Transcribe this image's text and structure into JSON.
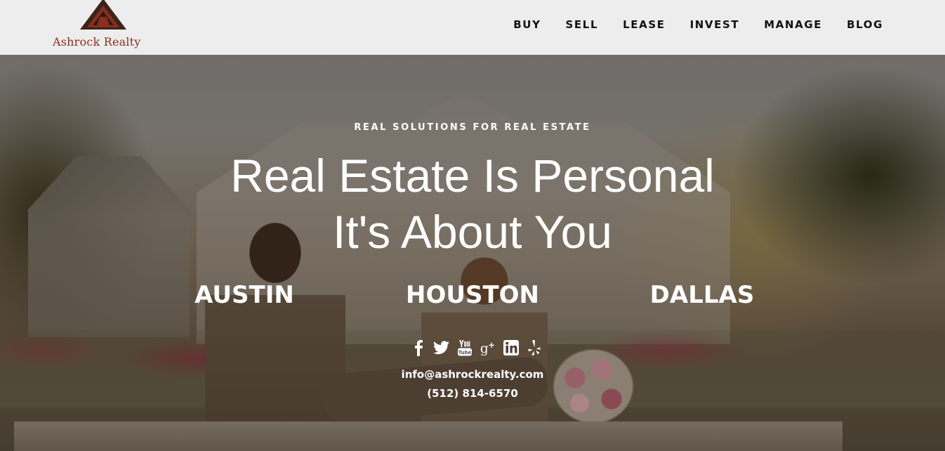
{
  "brand": {
    "name": "Ashrock Realty",
    "colors": {
      "logo_red": "#8a2d1f",
      "logo_dark": "#3a2418"
    }
  },
  "nav": {
    "items": [
      {
        "label": "BUY"
      },
      {
        "label": "SELL"
      },
      {
        "label": "LEASE"
      },
      {
        "label": "INVEST"
      },
      {
        "label": "MANAGE"
      },
      {
        "label": "BLOG"
      }
    ]
  },
  "hero": {
    "tagline": "REAL SOLUTIONS FOR REAL ESTATE",
    "headline_line1": "Real Estate Is Personal",
    "headline_line2": "It's About You",
    "cities": [
      {
        "label": "AUSTIN"
      },
      {
        "label": "HOUSTON"
      },
      {
        "label": "DALLAS"
      }
    ]
  },
  "social": {
    "icons": [
      "facebook-icon",
      "twitter-icon",
      "youtube-icon",
      "google-plus-icon",
      "linkedin-icon",
      "yelp-icon"
    ]
  },
  "contact": {
    "email": "info@ashrockrealty.com",
    "phone": "(512) 814-6570"
  }
}
